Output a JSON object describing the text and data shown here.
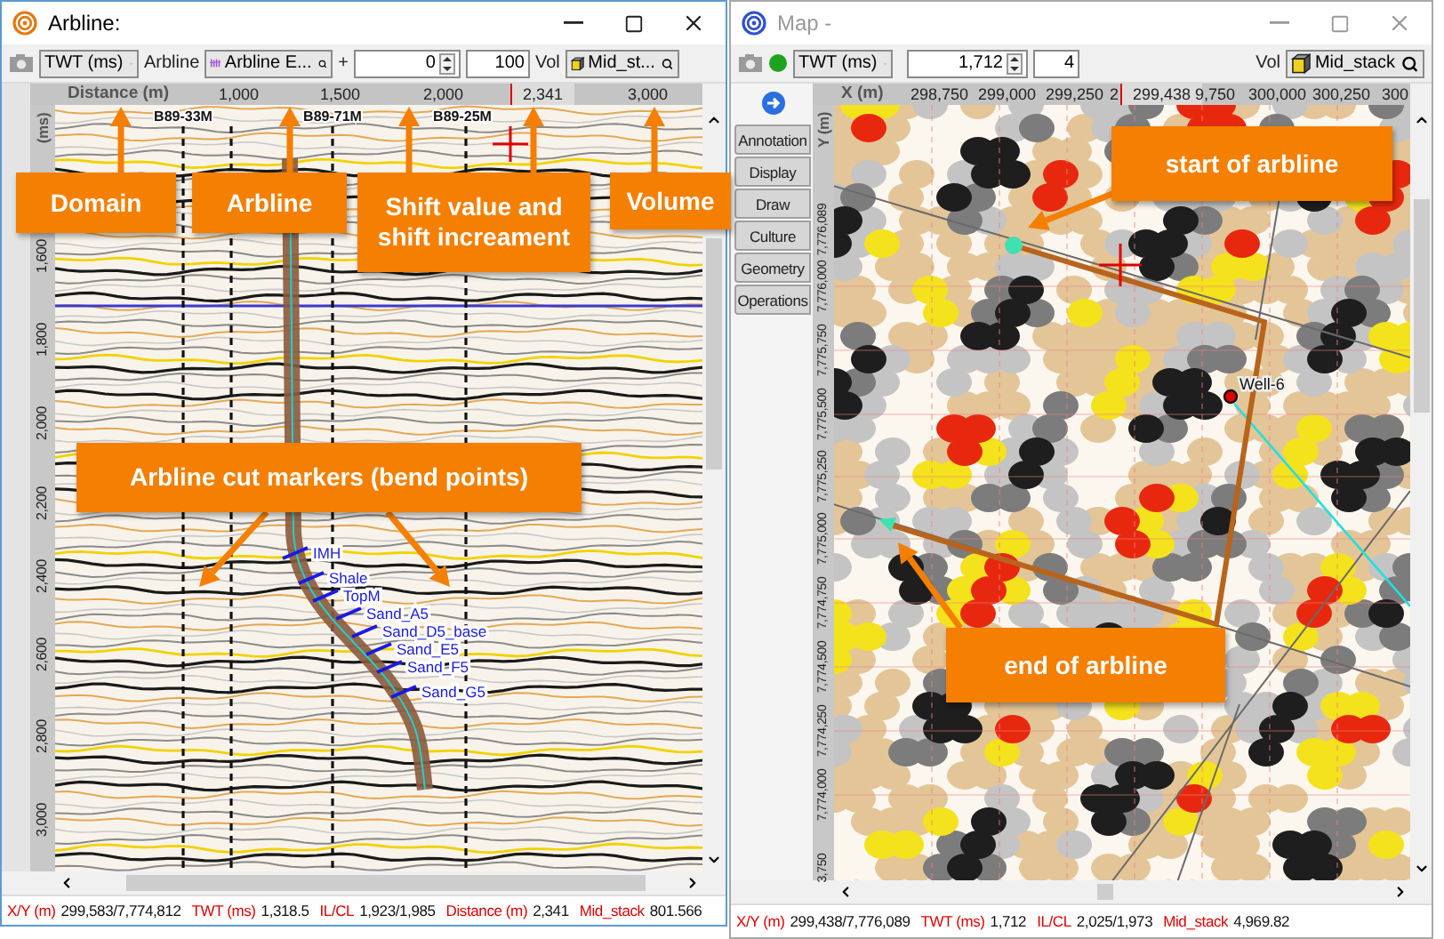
{
  "arbline_window": {
    "title": "Arbline:",
    "active": true,
    "toolbar": {
      "domain": "TWT (ms)",
      "arbline_label": "Arbline",
      "arbline": "Arbline E...",
      "plus": "+",
      "shift_value": "0",
      "shift_step": "100",
      "vol_label": "Vol",
      "volume": "Mid_st..."
    },
    "x_axis": {
      "title": "Distance (m)",
      "ticks": [
        {
          "label": "1,000",
          "cursor": false
        },
        {
          "label": "1,500",
          "cursor": false
        },
        {
          "label": "2,000",
          "cursor": false
        },
        {
          "label": "2,341",
          "cursor": true
        },
        {
          "label": "3,000",
          "cursor": false
        }
      ]
    },
    "y_axis": {
      "title": "(ms)",
      "ticks": [
        "1,600",
        "1,800",
        "2,000",
        "2,200",
        "2,400",
        "2,600",
        "2,800",
        "3,000"
      ]
    },
    "wells": [
      "B89-33M",
      "B89-71M",
      "B89-25M"
    ],
    "well_markers": [
      "IMH",
      "Shale",
      "TopM",
      "Sand_A5",
      "Sand_D5_base",
      "Sand_E5",
      "Sand_F5",
      "Sand_G5"
    ],
    "status": [
      {
        "label": "X/Y (m)",
        "value": "299,583/7,774,812"
      },
      {
        "label": "TWT (ms)",
        "value": "1,318.5"
      },
      {
        "label": "IL/CL",
        "value": "1,923/1,985"
      },
      {
        "label": "Distance (m)",
        "value": "2,341"
      },
      {
        "label": "Mid_stack",
        "value": "801.566"
      }
    ]
  },
  "map_window": {
    "title": "Map -",
    "active": false,
    "toolbar": {
      "domain": "TWT (ms)",
      "value": "1,712",
      "step": "4",
      "vol_label": "Vol",
      "volume": "Mid_stack"
    },
    "side_tabs": [
      {
        "label": "Annotation",
        "selected": false
      },
      {
        "label": "Display",
        "selected": false
      },
      {
        "label": "Draw",
        "selected": false
      },
      {
        "label": "Culture",
        "selected": false
      },
      {
        "label": "Geometry",
        "selected": false
      },
      {
        "label": "Operations",
        "selected": false
      }
    ],
    "x_axis": {
      "title": "X (m)",
      "ticks": [
        {
          "label": "298,750",
          "cursor": false
        },
        {
          "label": "299,000",
          "cursor": false
        },
        {
          "label": "299,250",
          "cursor": false
        },
        {
          "label": "2",
          "cursor": false
        },
        {
          "label": "299,438",
          "cursor": true
        },
        {
          "label": "9,750",
          "cursor": false
        },
        {
          "label": "300,000",
          "cursor": false
        },
        {
          "label": "300,250",
          "cursor": false
        },
        {
          "label": "300",
          "cursor": false
        }
      ]
    },
    "y_axis": {
      "title": "Y (m)",
      "ticks": [
        "7,776,089",
        "7,776,000",
        "7,775,750",
        "7,775,500",
        "7,775,250",
        "7,775,000",
        "7,774,750",
        "7,774,500",
        "7,774,250",
        "7,774,000",
        "3,750"
      ]
    },
    "well": "Well-6",
    "status": [
      {
        "label": "X/Y (m)",
        "value": "299,438/7,776,089"
      },
      {
        "label": "TWT (ms)",
        "value": "1,712"
      },
      {
        "label": "IL/CL",
        "value": "2,025/1,973"
      },
      {
        "label": "Mid_stack",
        "value": "4,969.82"
      }
    ]
  },
  "callouts": [
    {
      "text": "Domain"
    },
    {
      "text": "Arbline"
    },
    {
      "text": "Shift value and shift increament"
    },
    {
      "text": "Volume"
    },
    {
      "text": "Arbline cut markers (bend points)"
    },
    {
      "text": "start of arbline"
    },
    {
      "text": "end of arbline"
    }
  ]
}
